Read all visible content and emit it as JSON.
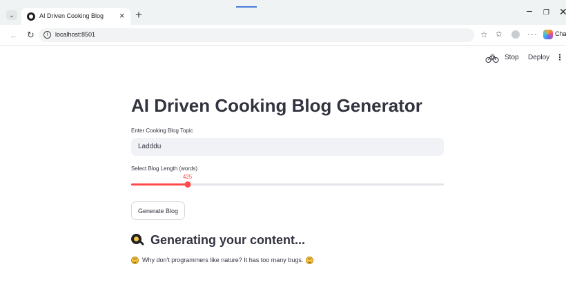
{
  "browser": {
    "tab_title": "AI Driven Cooking Blog",
    "tab_close": "×",
    "new_tab": "+",
    "url": "localhost:8501",
    "copilot_label": "Cha"
  },
  "header": {
    "stop_label": "Stop",
    "deploy_label": "Deploy"
  },
  "main": {
    "title": "AI Driven Cooking Blog Generator",
    "topic": {
      "label": "Enter Cooking Blog Topic",
      "value": "Ladddu"
    },
    "length_slider": {
      "label": "Select Blog Length (words)",
      "value": 425,
      "value_text": "425",
      "fraction": 0.18
    },
    "generate_button": "Generate Blog",
    "loading_heading": "Generating your content...",
    "joke": "Why don't programmers like nature? It has too many bugs."
  },
  "colors": {
    "accent": "#ff4b4b",
    "text": "#31333f",
    "input_bg": "#f0f2f6"
  },
  "icons": [
    "dropdown-icon",
    "favicon",
    "back-arrow-icon",
    "reload-icon",
    "info-icon",
    "star-icon",
    "favorites-icon",
    "profile-icon",
    "more-icon",
    "copilot-icon",
    "running-icon",
    "kebab-menu-icon",
    "magnifier-icon",
    "smile-icon"
  ]
}
